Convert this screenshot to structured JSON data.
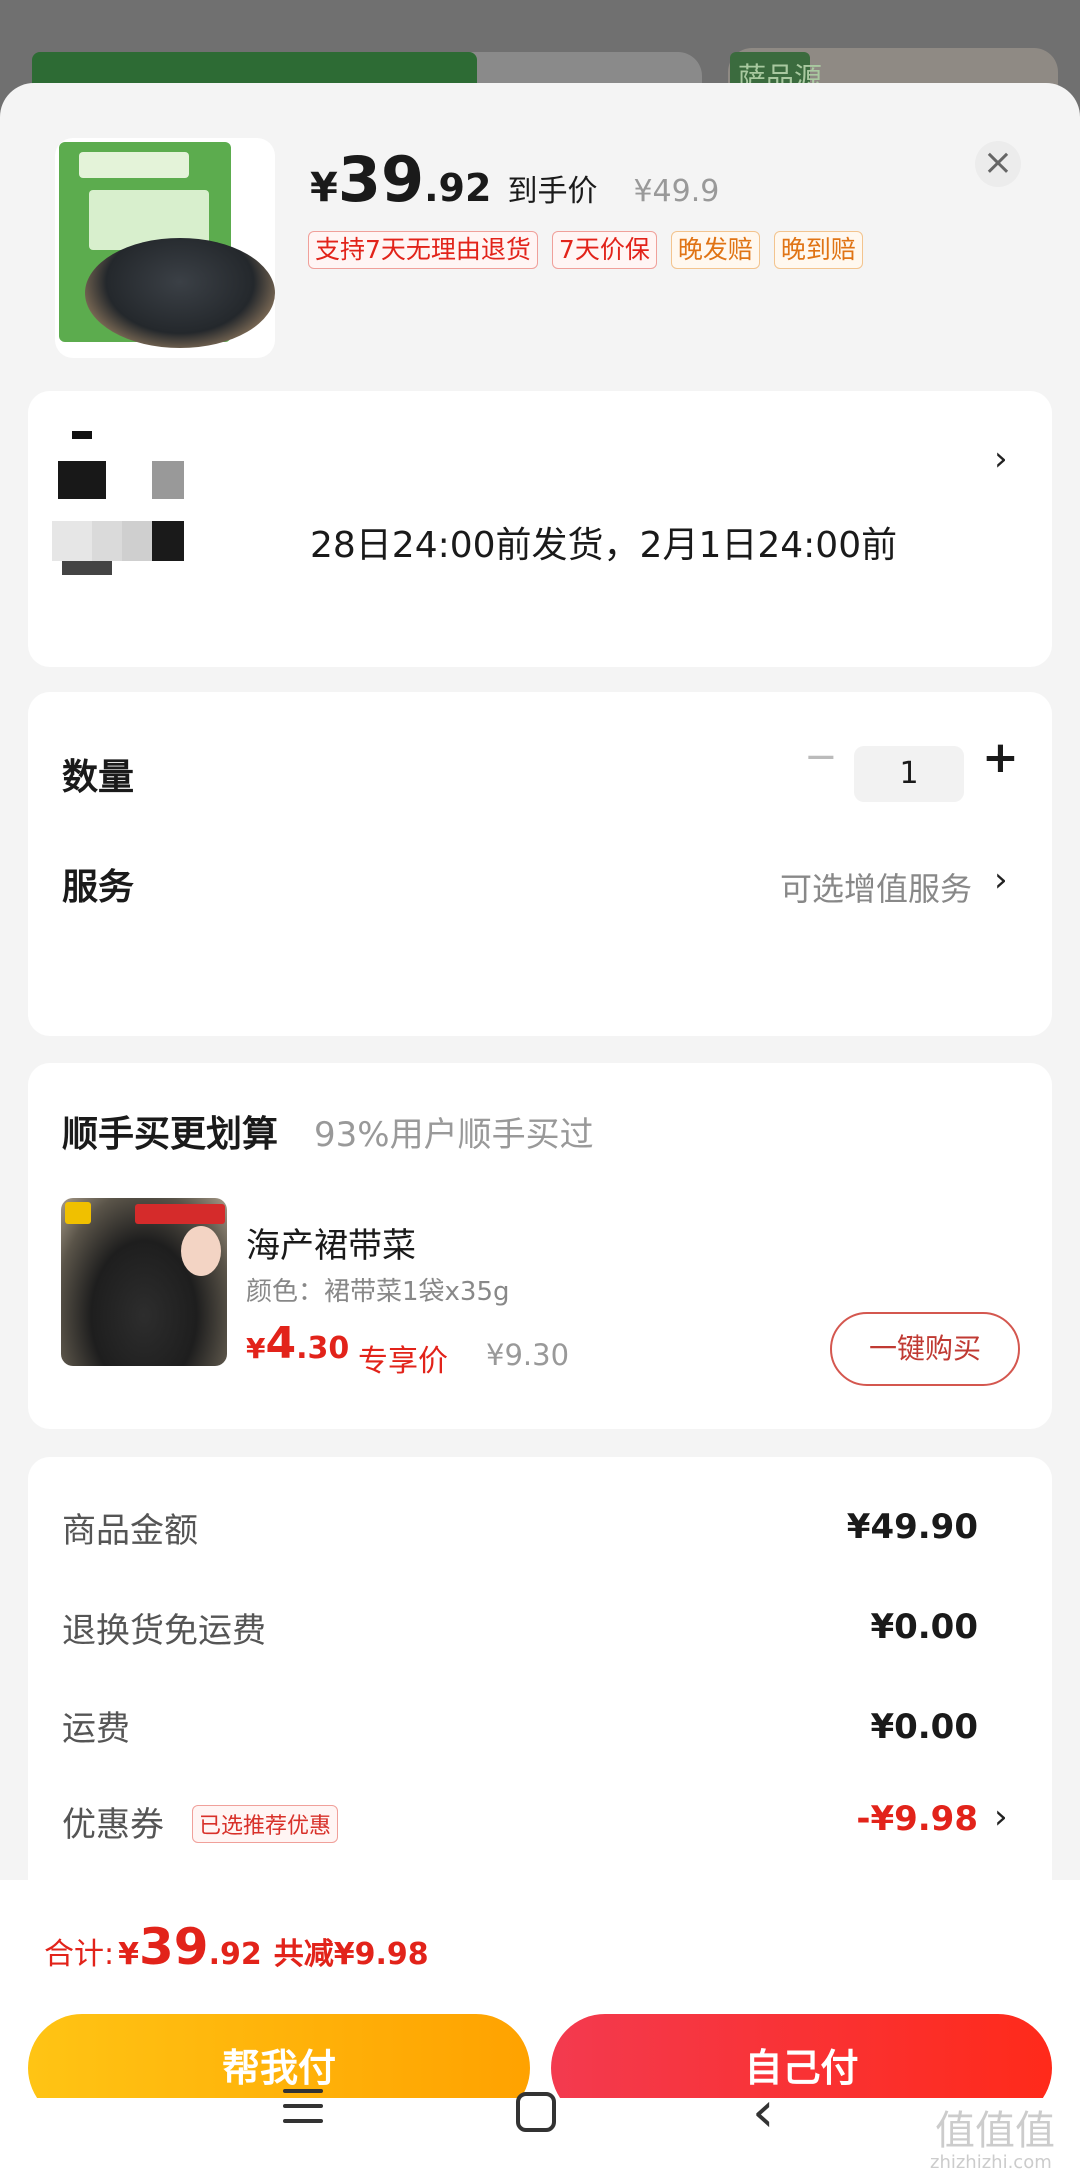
{
  "background": {
    "brand_mark": "萨品源"
  },
  "product": {
    "price_symbol": "¥",
    "price_int": "39",
    "price_dec": ".92",
    "price_label": "到手价",
    "orig_price": "¥49.9",
    "tags": [
      "支持7天无理由退货",
      "7天价保",
      "晚发赔",
      "晚到赔"
    ],
    "close_icon": "close-icon"
  },
  "address": {
    "delivery_text": "28日24:00前发货，2月1日24:00前",
    "chevron": "›"
  },
  "quantity": {
    "label": "数量",
    "minus": "−",
    "value": "1",
    "plus": "+"
  },
  "service": {
    "label": "服务",
    "hint": "可选增值服务",
    "chevron": "›"
  },
  "combo": {
    "title": "顺手买更划算",
    "subtitle": "93%用户顺手买过",
    "item_name": "海产裙带菜",
    "item_spec": "颜色：裙带菜1袋x35g",
    "price_symbol": "¥",
    "price_int": "4",
    "price_dec": ".30",
    "exclusive_label": "专享价",
    "orig_price": "¥9.30",
    "buy_label": "一键购买"
  },
  "summary": {
    "rows": [
      {
        "label": "商品金额",
        "value": "¥49.90"
      },
      {
        "label": "退换货免运费",
        "value": "¥0.00"
      },
      {
        "label": "运费",
        "value": "¥0.00"
      },
      {
        "label": "优惠券",
        "value": "-¥9.98"
      }
    ],
    "coupon_tag": "已选推荐优惠",
    "chevron": "›"
  },
  "footer": {
    "total_label": "合计:",
    "total_symbol": "¥",
    "total_int": "39",
    "total_dec": ".92",
    "reduce_text": "共减¥9.98",
    "help_pay": "帮我付",
    "self_pay": "自己付"
  },
  "watermark": {
    "main": "值值值",
    "sub": "zhizhizhi.com"
  },
  "colors": {
    "accent_red": "#e2231a",
    "accent_orange": "#ffa200"
  }
}
